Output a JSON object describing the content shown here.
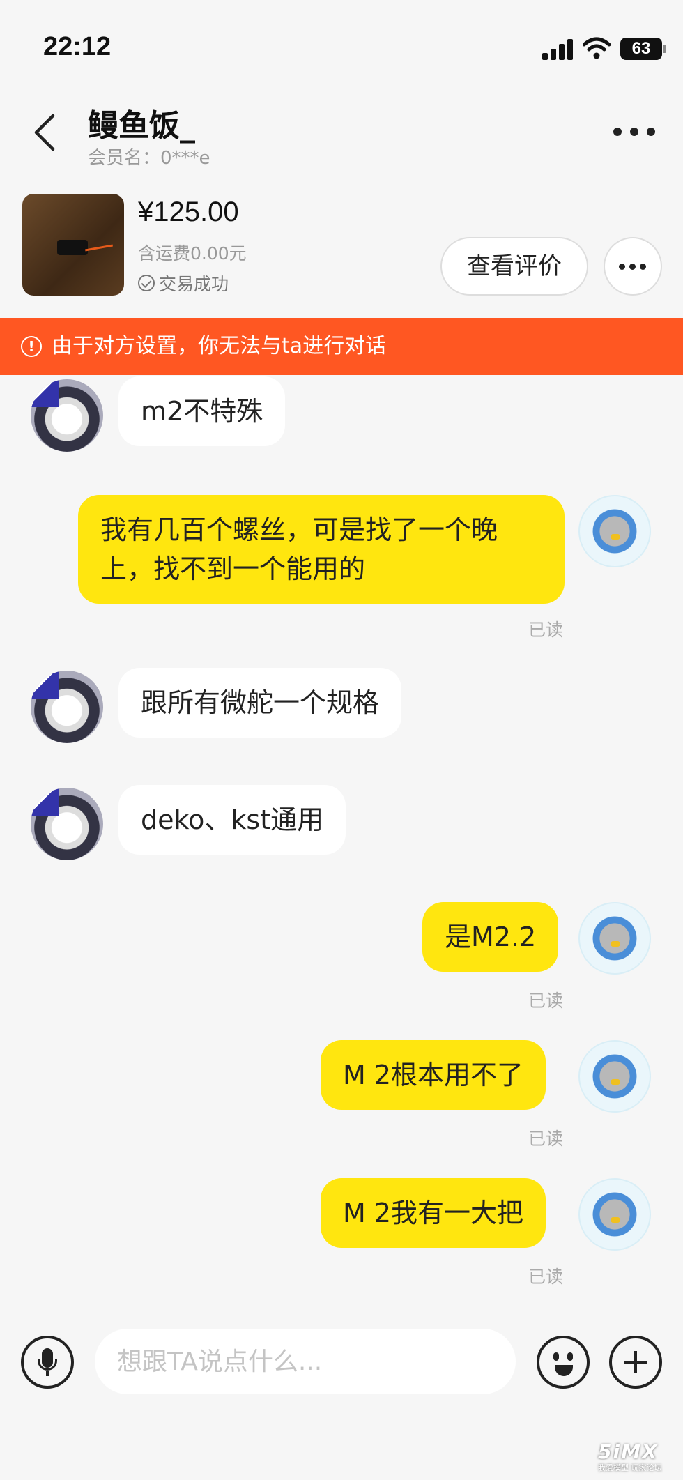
{
  "status_bar": {
    "time": "22:12",
    "battery": "63"
  },
  "header": {
    "contact_name": "鳗鱼饭_",
    "member_name": "会员名：0***e"
  },
  "product": {
    "price": "¥125.00",
    "shipping": "含运费0.00元",
    "status": "交易成功",
    "review_button": "查看评价"
  },
  "notice": {
    "icon": "!",
    "text": "由于对方设置，你无法与ta进行对话"
  },
  "messages": [
    {
      "side": "left",
      "text": "m2不特殊"
    },
    {
      "side": "right",
      "text": "我有几百个螺丝，可是找了一个晚上，找不到一个能用的",
      "read": "已读"
    },
    {
      "side": "left",
      "text": "跟所有微舵一个规格"
    },
    {
      "side": "left",
      "text": "deko、kst通用"
    },
    {
      "side": "right",
      "text": "是M2.2",
      "read": "已读"
    },
    {
      "side": "right",
      "text": "M 2根本用不了",
      "read": "已读"
    },
    {
      "side": "right",
      "text": "M 2我有一大把",
      "read": "已读"
    }
  ],
  "input": {
    "placeholder": "想跟TA说点什么..."
  },
  "watermark": {
    "logo": "5iMX",
    "sub": "我爱模型 玩家论坛"
  }
}
